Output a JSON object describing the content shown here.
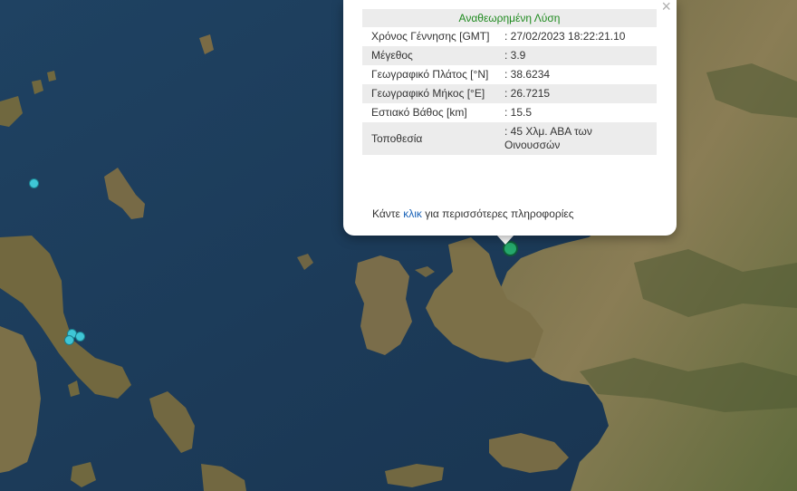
{
  "popup": {
    "title": "Αναθεωρημένη Λύση",
    "close_glyph": "×",
    "rows": [
      {
        "label": "Χρόνος Γέννησης [GMT]",
        "value": ": 27/02/2023 18:22:21.10"
      },
      {
        "label": "Μέγεθος",
        "value": ": 3.9"
      },
      {
        "label": "Γεωγραφικό Πλάτος [°N]",
        "value": ": 38.6234"
      },
      {
        "label": "Γεωγραφικό Μήκος [°E]",
        "value": ": 26.7215"
      },
      {
        "label": "Εστιακό Βάθος [km]",
        "value": ": 15.5"
      },
      {
        "label": "Τοποθεσία",
        "value": ": 45 Χλμ. ΑΒΑ των Οινουσσών"
      }
    ],
    "more_prefix": "Κάντε ",
    "more_link": "κλικ",
    "more_suffix": " για περισσότερες πληροφορίες"
  },
  "colors": {
    "sea": "#1d3b56",
    "land": "#8a7a52",
    "main_marker": "#25a86b",
    "other_marker": "#3fc6d6",
    "title_green": "#1f8a1f"
  }
}
